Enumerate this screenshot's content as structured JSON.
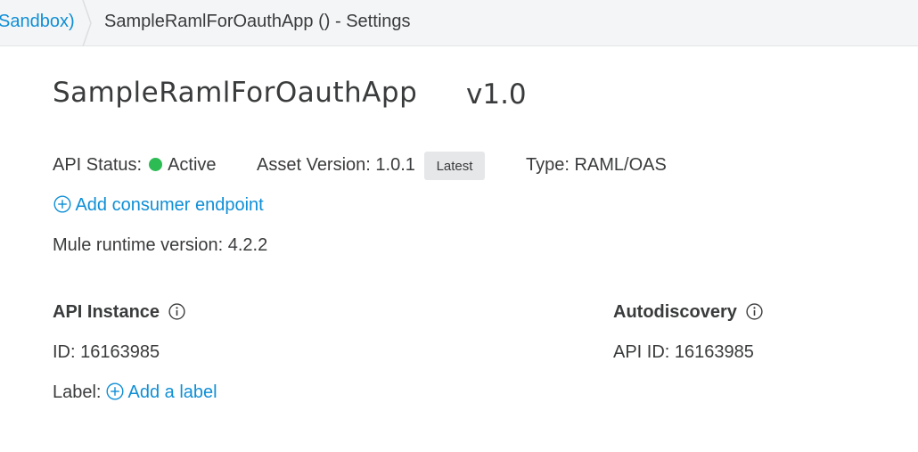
{
  "breadcrumb": {
    "environment": "Sandbox)",
    "page": "SampleRamlForOauthApp () - Settings"
  },
  "api": {
    "name": "SampleRamlForOauthApp",
    "version": "v1.0",
    "status_label": "API Status:",
    "status_value": "Active",
    "status_color": "#2dbb54",
    "asset_version_label": "Asset Version: 1.0.1",
    "latest_badge": "Latest",
    "type_label": "Type: RAML/OAS",
    "add_endpoint": "Add consumer endpoint",
    "runtime": "Mule runtime version: 4.2.2"
  },
  "instance": {
    "title": "API Instance",
    "id_text": "ID: 16163985",
    "label_text": "Label:",
    "add_label": "Add a label"
  },
  "autodiscovery": {
    "title": "Autodiscovery",
    "api_id_text": "API ID: 16163985"
  },
  "colors": {
    "accent": "#0f8fd6",
    "text": "#3a3b3c",
    "header_bg": "#f4f5f6"
  },
  "icons": {
    "add": "plus-circle-icon",
    "info": "info-circle-icon"
  }
}
